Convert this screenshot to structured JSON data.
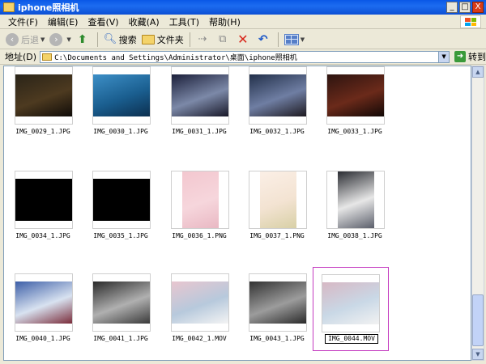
{
  "window": {
    "title": "iphone照相机"
  },
  "title_buttons": [
    "_",
    "□",
    "X"
  ],
  "menu": [
    "文件(F)",
    "编辑(E)",
    "查看(V)",
    "收藏(A)",
    "工具(T)",
    "帮助(H)"
  ],
  "toolbar": {
    "back": "后退",
    "search": "搜索",
    "folders": "文件夹"
  },
  "address": {
    "label": "地址(D)",
    "path": "C:\\Documents and Settings\\Administrator\\桌面\\iphone照相机",
    "go": "转到"
  },
  "files": [
    {
      "name": "IMG_0029_1.JPG",
      "thumb": [
        "#2a2418",
        "#4d3a20",
        "#100c08"
      ]
    },
    {
      "name": "IMG_0030_1.JPG",
      "thumb": [
        "#3d8fc7",
        "#1a5e8f",
        "#0c2f4f"
      ]
    },
    {
      "name": "IMG_0031_1.JPG",
      "thumb": [
        "#1b1f3a",
        "#7c89a8",
        "#181828"
      ]
    },
    {
      "name": "IMG_0032_1.JPG",
      "thumb": [
        "#22304a",
        "#6f7ea3",
        "#1e1a20"
      ]
    },
    {
      "name": "IMG_0033_1.JPG",
      "thumb": [
        "#2d1410",
        "#6b2a1a",
        "#120806"
      ]
    },
    {
      "name": "IMG_0034_1.JPG",
      "thumb": [
        "#000000",
        "#000000",
        "#000000"
      ]
    },
    {
      "name": "IMG_0035_1.JPG",
      "thumb": [
        "#000000",
        "#000000",
        "#000000"
      ]
    },
    {
      "name": "IMG_0036_1.PNG",
      "thumb": [
        "#f3c7cf",
        "#f6d6dc",
        "#e9b8c3"
      ]
    },
    {
      "name": "IMG_0037_1.PNG",
      "thumb": [
        "#fbefe6",
        "#f3e3d2",
        "#d8d0a6"
      ]
    },
    {
      "name": "IMG_0038_1.JPG",
      "thumb": [
        "#2a2c32",
        "#e7e7e7",
        "#5b5f6b"
      ]
    },
    {
      "name": "IMG_0040_1.JPG",
      "thumb": [
        "#3d5fa8",
        "#d8e2f0",
        "#7a2c3a"
      ]
    },
    {
      "name": "IMG_0041_1.JPG",
      "thumb": [
        "#2a2a2a",
        "#b0b0b0",
        "#3a3a3a"
      ]
    },
    {
      "name": "IMG_0042_1.MOV",
      "thumb": [
        "#e8c6cf",
        "#b7c9dc",
        "#f4f4f4"
      ]
    },
    {
      "name": "IMG_0043_1.JPG",
      "thumb": [
        "#333333",
        "#9c9c9c",
        "#2a2a2a"
      ]
    },
    {
      "name": "IMG_0044.MOV",
      "thumb": [
        "#d7b8c4",
        "#c9d8e6",
        "#f2f2f2"
      ],
      "selected": true
    }
  ],
  "colors": {
    "selection_border": "#c43bc0",
    "titlebar": "#0a58e6"
  }
}
